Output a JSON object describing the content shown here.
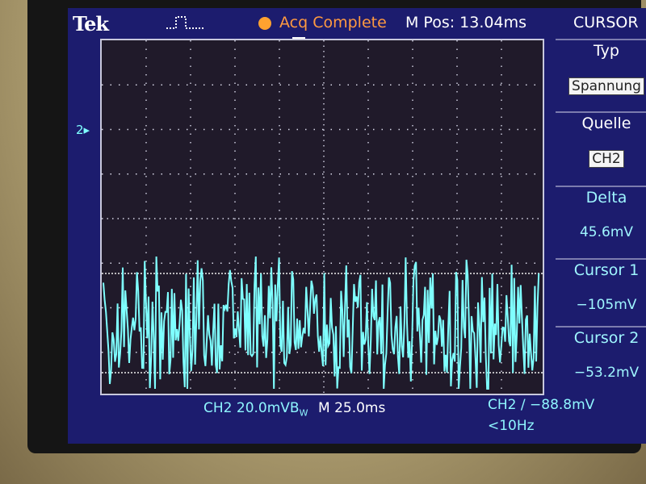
{
  "status_bar": {
    "logo": "Tek",
    "acq_status": "Acq Complete",
    "m_pos": "M Pos: 13.04ms",
    "acq_dot_color": "#ffa230"
  },
  "side_menu": {
    "title": "CURSOR",
    "items": [
      {
        "label": "Typ",
        "value": "Spannung",
        "boxed": true
      },
      {
        "label": "Quelle",
        "value": "CH2",
        "boxed": true
      },
      {
        "label": "Delta",
        "value": "45.6mV",
        "boxed": false
      },
      {
        "label": "Cursor 1",
        "value": "−105mV",
        "boxed": false
      },
      {
        "label": "Cursor 2",
        "value": "−53.2mV",
        "boxed": false
      }
    ]
  },
  "channel_marker": "2",
  "bottom_bar": {
    "ch_scale": "CH2  20.0mV",
    "bw_mark": "B",
    "bw_sub": "W",
    "time_scale": "M 25.0ms",
    "trigger_readout": "CH2 ∕ −88.8mV",
    "freq_readout": "<10Hz"
  },
  "colors": {
    "trace": "#7fffff",
    "screen_bg": "#1c1c6e",
    "graticule_bg": "#201a2a",
    "accent_orange": "#ff9a40"
  },
  "icons": {
    "trigger_state": "pulse-waveform-icon",
    "trigger_pos": "trigger-arrow-icon"
  }
}
